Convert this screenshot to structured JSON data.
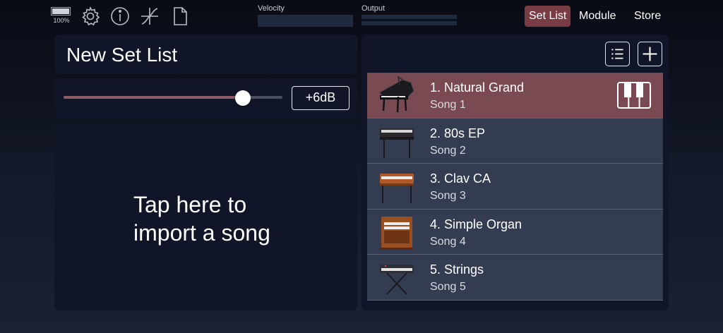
{
  "status": {
    "battery_percent": "100%"
  },
  "meters": {
    "velocity_label": "Velocity",
    "output_label": "Output"
  },
  "nav": {
    "set_list": "Set List",
    "module": "Module",
    "store": "Store",
    "active": "Set List"
  },
  "icons": [
    "battery-icon",
    "gear-icon",
    "info-icon",
    "curve-icon",
    "document-icon",
    "list-icon",
    "plus-icon",
    "piano-keys-icon"
  ],
  "colors": {
    "accent": "#7a3c44",
    "selected_row": "#7a4a52",
    "row_bg": "#343c51",
    "panel_bg": "#101628"
  },
  "setlist": {
    "title": "New Set List",
    "volume_fraction": 0.82,
    "gain_label": "+6dB",
    "import_line1": "Tap here to",
    "import_line2": "import a song"
  },
  "songs": [
    {
      "name": "1. Natural Grand",
      "subtitle": "Song 1",
      "selected": true
    },
    {
      "name": "2. 80s EP",
      "subtitle": "Song 2",
      "selected": false
    },
    {
      "name": "3. Clav CA",
      "subtitle": "Song 3",
      "selected": false
    },
    {
      "name": "4. Simple Organ",
      "subtitle": "Song 4",
      "selected": false
    },
    {
      "name": "5. Strings",
      "subtitle": "Song 5",
      "selected": false
    }
  ]
}
